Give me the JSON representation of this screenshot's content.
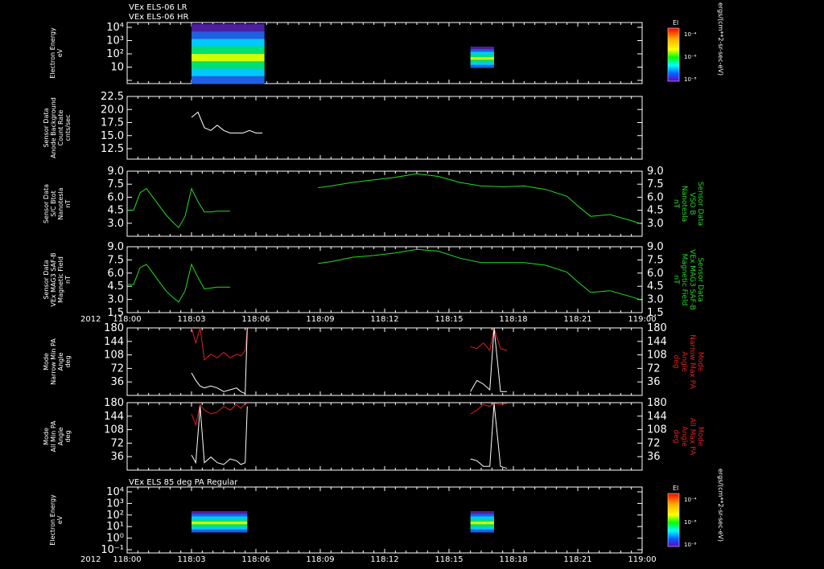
{
  "top_titles": [
    "VEx ELS-06 LR",
    "VEx ELS-06 HR"
  ],
  "bottom_title": "VEx ELS 85 deg PA Regular",
  "year_label": "2012",
  "x_ticks": [
    "118:00",
    "118:03",
    "118:06",
    "118:09",
    "118:12",
    "118:15",
    "118:18",
    "118:21",
    "119:00"
  ],
  "colorbar_top": {
    "title": "El",
    "ticks": [
      "10⁻⁴",
      "10⁻⁶",
      "10⁻⁸"
    ],
    "unit": "ergs/(cm**2-sr-sec-eV)"
  },
  "colorbar_bottom": {
    "title": "El",
    "ticks": [
      "10⁻⁴",
      "10⁻⁶",
      "10⁻⁸"
    ],
    "unit": "ergs/(cm**2-sr-sec-eV)"
  },
  "colors": {
    "white": "#ffffff",
    "green": "#22dd22",
    "red": "#e02020",
    "bg": "#000000"
  },
  "chart_data": [
    {
      "type": "heatmap",
      "ylabel": [
        "Electron Energy",
        "eV"
      ],
      "yticks": [
        "10⁴",
        "10³",
        "10²",
        "10",
        ""
      ],
      "blocks": [
        {
          "x_start": 3,
          "x_end": 6.4
        },
        {
          "x_start": 16.0,
          "x_end": 17.1
        }
      ]
    },
    {
      "type": "line",
      "ylabel": [
        "Sensor Data",
        "Anode Background",
        "Count Rate",
        "cnts/sec"
      ],
      "yticks": [
        "22.5",
        "20.0",
        "17.5",
        "15.0",
        "12.5"
      ],
      "ylim": [
        10.5,
        22.5
      ],
      "series": [
        {
          "color": "white",
          "x": [
            3.0,
            3.3,
            3.6,
            3.9,
            4.2,
            4.5,
            4.8,
            5.1,
            5.4,
            5.7,
            6.0,
            6.3
          ],
          "values": [
            18.5,
            19.5,
            16.5,
            16,
            17,
            16,
            15.5,
            15.5,
            15.5,
            16,
            15.5,
            15.5
          ]
        }
      ]
    },
    {
      "type": "line",
      "ylabel": [
        "Sensor Data",
        "S/C Btot",
        "Nanotesla",
        "nT"
      ],
      "ylabel_right": [
        "Sensor Data",
        "VSO B",
        "Nanotesla",
        "nT"
      ],
      "yticks": [
        "9.0",
        "7.5",
        "6.0",
        "4.5",
        "3.0"
      ],
      "ylim": [
        1.5,
        9.0
      ],
      "series": [
        {
          "color": "green",
          "x": [
            0.0,
            0.3,
            0.6,
            0.9,
            1.2,
            1.5,
            1.8,
            2.1,
            2.4,
            2.7,
            3.0,
            3.3,
            3.6,
            3.9,
            4.2,
            4.5,
            4.8
          ],
          "values": [
            4.5,
            4.5,
            6.5,
            7.0,
            6.0,
            5.0,
            4.0,
            3.2,
            2.5,
            3.8,
            7.0,
            5.5,
            4.3,
            4.3,
            4.4,
            4.4,
            4.4
          ]
        },
        {
          "color": "green",
          "x": [
            8.9,
            9.5,
            10.5,
            11.5,
            12.5,
            13.5,
            14.5,
            15.5,
            16.5,
            17.5,
            18.5,
            19.5,
            20.5,
            21.0,
            21.6,
            22.5,
            23.5,
            24.0
          ],
          "values": [
            7.1,
            7.3,
            7.7,
            8.0,
            8.3,
            8.7,
            8.4,
            7.7,
            7.3,
            7.2,
            7.3,
            6.9,
            6.1,
            5.0,
            3.8,
            4.0,
            3.3,
            2.9
          ]
        }
      ]
    },
    {
      "type": "line",
      "ylabel": [
        "Sensor Data",
        "VEx MAG3 SAF-B",
        "Magnetic Field",
        "nT"
      ],
      "ylabel_right": [
        "Sensor Data",
        "VEx MAG3 SAF-B",
        "Magnetic Field",
        "nT"
      ],
      "yticks": [
        "9.0",
        "7.5",
        "6.0",
        "4.5",
        "3.0",
        "1.5"
      ],
      "ylim": [
        1.5,
        9.0
      ],
      "series": [
        {
          "color": "green",
          "x": [
            0.0,
            0.3,
            0.6,
            0.9,
            1.2,
            1.5,
            1.8,
            2.1,
            2.4,
            2.7,
            3.0,
            3.3,
            3.6,
            3.9,
            4.2,
            4.5,
            4.8
          ],
          "values": [
            4.7,
            4.7,
            6.6,
            7.0,
            6.0,
            5.0,
            4.0,
            3.3,
            2.7,
            4.0,
            7.0,
            5.5,
            4.2,
            4.3,
            4.4,
            4.4,
            4.4
          ]
        },
        {
          "color": "green",
          "x": [
            8.9,
            9.5,
            10.5,
            11.5,
            12.5,
            13.5,
            14.5,
            15.5,
            16.5,
            17.5,
            18.5,
            19.5,
            20.5,
            21.0,
            21.6,
            22.5,
            23.5,
            24.0
          ],
          "values": [
            7.1,
            7.3,
            7.8,
            8.0,
            8.3,
            8.7,
            8.5,
            7.7,
            7.2,
            7.2,
            7.2,
            6.9,
            6.1,
            5.0,
            3.8,
            4.0,
            3.3,
            2.9
          ]
        }
      ]
    },
    {
      "type": "line",
      "ylabel": [
        "Mode",
        "Narrow Min PA",
        "Angle",
        "deg"
      ],
      "ylabel_right": [
        "Mode",
        "Narrow Max PA",
        "Angle",
        "deg"
      ],
      "yticks": [
        "180",
        "144",
        "108",
        "72",
        "36"
      ],
      "ylim": [
        0,
        180
      ],
      "series": [
        {
          "color": "red",
          "x": [
            3.0,
            3.2,
            3.4,
            3.6,
            3.9,
            4.2,
            4.5,
            4.8,
            5.1,
            5.3,
            5.5,
            5.6
          ],
          "values": [
            180,
            140,
            180,
            95,
            110,
            100,
            115,
            100,
            110,
            105,
            120,
            180
          ]
        },
        {
          "color": "white",
          "x": [
            3.0,
            3.2,
            3.4,
            3.6,
            3.9,
            4.2,
            4.5,
            4.8,
            5.1,
            5.3,
            5.5,
            5.6
          ],
          "values": [
            60,
            40,
            25,
            20,
            25,
            20,
            10,
            15,
            20,
            10,
            5,
            180
          ]
        },
        {
          "color": "red",
          "x": [
            16.0,
            16.3,
            16.6,
            16.9,
            17.1,
            17.4,
            17.7
          ],
          "values": [
            130,
            125,
            140,
            120,
            180,
            125,
            120
          ]
        },
        {
          "color": "white",
          "x": [
            16.0,
            16.3,
            16.6,
            16.9,
            17.1,
            17.4,
            17.7
          ],
          "values": [
            10,
            40,
            30,
            15,
            180,
            10,
            10
          ]
        }
      ]
    },
    {
      "type": "line",
      "ylabel": [
        "Mode",
        "All Min PA",
        "Angle",
        "deg"
      ],
      "ylabel_right": [
        "Mode",
        "All Max PA",
        "Angle",
        "deg"
      ],
      "yticks": [
        "180",
        "144",
        "108",
        "72",
        "36"
      ],
      "ylim": [
        0,
        180
      ],
      "series": [
        {
          "color": "red",
          "x": [
            3.0,
            3.2,
            3.4,
            3.6,
            3.9,
            4.2,
            4.5,
            4.8,
            5.1,
            5.3,
            5.5,
            5.6
          ],
          "values": [
            150,
            120,
            175,
            160,
            150,
            155,
            170,
            160,
            175,
            165,
            178,
            178
          ]
        },
        {
          "color": "white",
          "x": [
            3.0,
            3.2,
            3.4,
            3.6,
            3.9,
            4.2,
            4.5,
            4.8,
            5.1,
            5.3,
            5.5,
            5.6
          ],
          "values": [
            40,
            20,
            170,
            20,
            35,
            20,
            15,
            30,
            25,
            15,
            20,
            170
          ]
        },
        {
          "color": "red",
          "x": [
            16.0,
            16.3,
            16.6,
            16.9,
            17.1,
            17.4,
            17.7
          ],
          "values": [
            150,
            160,
            175,
            170,
            178,
            175,
            178
          ]
        },
        {
          "color": "white",
          "x": [
            16.0,
            16.3,
            16.6,
            16.9,
            17.1,
            17.4,
            17.7
          ],
          "values": [
            30,
            25,
            10,
            10,
            178,
            10,
            5
          ]
        }
      ]
    },
    {
      "type": "heatmap",
      "ylabel": [
        "Electron Energy",
        "eV"
      ],
      "yticks": [
        "10⁴",
        "10³",
        "10²",
        "10¹",
        "10⁰",
        "10⁻¹"
      ],
      "blocks": [
        {
          "x_start": 3,
          "x_end": 5.6
        },
        {
          "x_start": 16.0,
          "x_end": 17.1
        }
      ]
    }
  ]
}
